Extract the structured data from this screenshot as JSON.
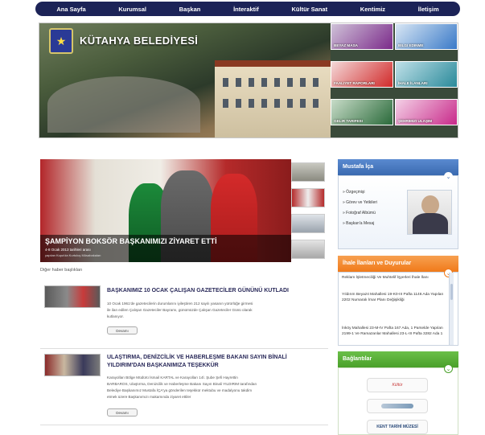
{
  "nav": {
    "items": [
      "Ana Sayfa",
      "Kurumsal",
      "Başkan",
      "İnteraktif",
      "Kültür Sanat",
      "Kentimiz",
      "İletişim"
    ]
  },
  "header": {
    "site_title": "KÜTAHYA BELEDİYESİ",
    "tiles": [
      {
        "label": "Beyaz Masa",
        "color": "#7b2a8a"
      },
      {
        "label": "Bilgi Edinme",
        "color": "#3a7ac8"
      },
      {
        "label": "Faaliyet Raporları",
        "color": "#d12a2a"
      },
      {
        "label": "İhale İlanları",
        "color": "#2a8a9a"
      },
      {
        "label": "Gelir Tarifesi",
        "color": "#2a6a3a"
      },
      {
        "label": "Şehrimizi Ulaşım",
        "color": "#c82a8a"
      }
    ]
  },
  "feature": {
    "title": "ŞAMPİYON BOKSÖR BAŞKANIMIZI ZİYARET ETTİ",
    "subtitle": "4-8 Ocak 2013 tarihleri arası",
    "subtitle2": "yapılan Kupa'da Kurtuluş Müsabakaları"
  },
  "more_headlines": "Diğer haber başlıkları",
  "news": [
    {
      "title": "BAŞKANIMIZ 10 OCAK ÇALIŞAN GAZETECİLER GÜNÜNÜ KUTLADI",
      "body_lines": [
        "10 Ocak 1961'de gazetecilerin durumlarını iyileştiren 212 sayılı yasanın yürürlüğe girmesi",
        "ile ilan edilen Çalışan Gazeteciler Bayramı, günümüzde Çalışan Gazeteciler Günü olarak",
        "kutlanıyor."
      ],
      "more": "Devamı"
    },
    {
      "title": "ULAŞTIRMA, DENİZCİLİK VE HABERLEŞME BAKANI SAYIN BİNALİ",
      "title2": "YILDIRIM'DAN BAŞKANIMIZA TEŞEKKÜR",
      "body_lines": [
        "Karayolları Bölge Müdürü İsmail KARTAL ve Karayolları 14İ. Şube Şefi Hayrettin",
        "BARBAROS, Ulaştırma, Denizcilik ve Haberleşme Bakanı Sayın Binali YILDIRIM tarafından",
        "Belediye Başkanımız Mustafa İÇA'ya gönderilen teşekkür mektubu ve madalyonu takdim",
        "etmek üzere Başkanımızı makamında ziyaret ettiler"
      ],
      "more": "Devamı"
    }
  ],
  "mayor_panel": {
    "title": "Mustafa İça",
    "links": [
      "Özgeçmişi",
      "Görev ve Yetkileri",
      "Fotoğraf Albümü",
      "Başkan'a Mesaj"
    ],
    "accent": "#3a6ab0"
  },
  "tenders_panel": {
    "title": "İhale İlanları ve Duyurular",
    "items": [
      "Reklam İşletmeciliği Ve Muhtelif İşyerleri İhale İlanı",
      "Yıldırım Beyazıt Mahallesi 19-K0-III Pafta 1146 Ada Yapılan 2202 Numaralı İmar Planı Değişikliği",
      "İnköy Mahallesi 23-M-IV Pafta 167 Ada, 1 Parselde Yapılan 2199-1 Ve Ramazanlar Mahallesi 23-L-III Pafta 3282 Ada 1"
    ],
    "accent": "#f07a1a"
  },
  "links_panel": {
    "title": "Bağlantılar",
    "items": [
      "Kültür",
      "",
      "KENT TARİHİ MÜZESİ"
    ],
    "accent": "#4aa02a"
  }
}
